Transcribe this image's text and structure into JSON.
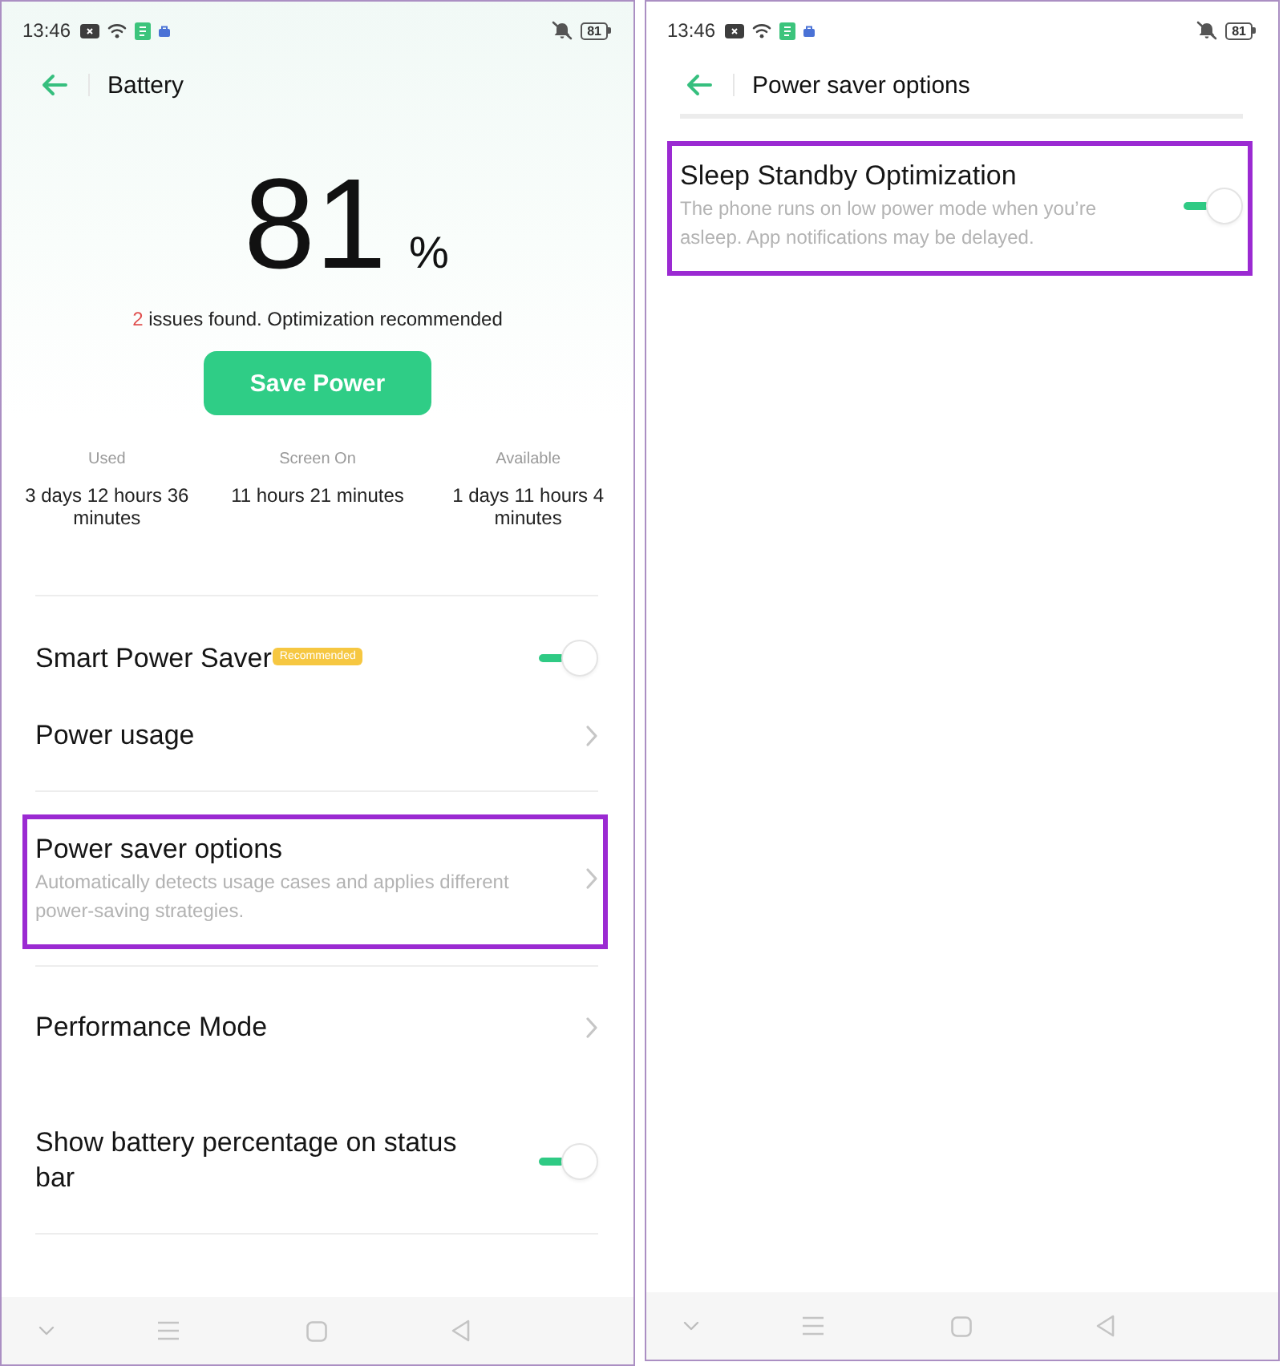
{
  "screens": [
    {
      "kind": "battery",
      "status_bar": {
        "time": "13:46",
        "battery": "81"
      },
      "header": {
        "title": "Battery"
      },
      "summary": {
        "percent": "81",
        "unit": "%",
        "issues_count": "2",
        "issues_text": "issues found. Optimization recommended",
        "button": "Save Power"
      },
      "stats": [
        {
          "label": "Used",
          "value": "3 days 12 hours 36 minutes"
        },
        {
          "label": "Screen On",
          "value": "11 hours 21 minutes"
        },
        {
          "label": "Available",
          "value": "1 days 11 hours 4 minutes"
        }
      ],
      "sections": [
        {
          "items": [
            {
              "kind": "toggle",
              "title": "Smart Power Saver",
              "badge": "Recommended",
              "on": true,
              "highlighted": false
            },
            {
              "kind": "link",
              "title": "Power usage",
              "highlighted": false
            }
          ]
        },
        {
          "items": [
            {
              "kind": "link",
              "title": "Power saver options",
              "description": "Automatically detects usage cases and applies different power-saving strategies.",
              "highlighted": true
            }
          ]
        },
        {
          "items": [
            {
              "kind": "link",
              "title": "Performance Mode",
              "highlighted": false
            },
            {
              "kind": "toggle",
              "title": "Show battery percentage on status bar",
              "on": true,
              "highlighted": false
            }
          ]
        }
      ]
    },
    {
      "kind": "options",
      "status_bar": {
        "time": "13:46",
        "battery": "81"
      },
      "header": {
        "title": "Power saver options"
      },
      "sections": [
        {
          "items": [
            {
              "kind": "toggle",
              "title": "Sleep Standby Optimization",
              "description": "The phone runs on low power mode when you’re asleep. App notifications may be delayed.",
              "on": true,
              "highlighted": true
            }
          ]
        }
      ]
    }
  ]
}
